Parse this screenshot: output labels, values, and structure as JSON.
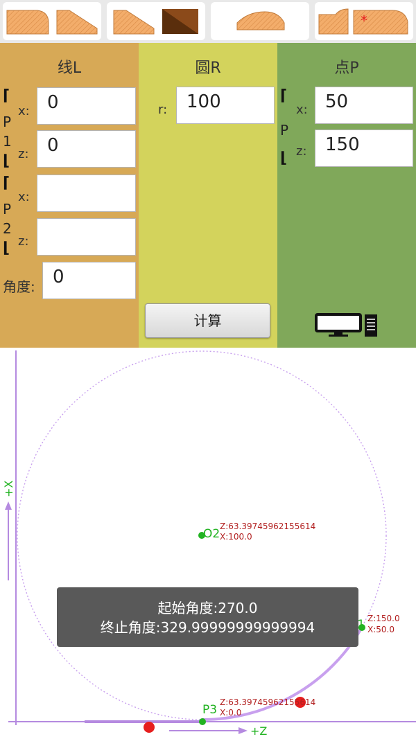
{
  "colors": {
    "shape_fill": "#f3ad6b",
    "shape_dark": "#8b4a1a",
    "line_panel": "#d7a956",
    "circle_panel": "#d3d35c",
    "point_panel": "#80a85a",
    "axis": "#b58ae0",
    "arc": "#c8a0ee",
    "marker_green": "#22b322",
    "marker_red": "#e61e1e",
    "coord_text": "#b22020",
    "axis_text": "#22b322"
  },
  "tabs": [
    {
      "icon": "corner-bevel-shapes-icon"
    },
    {
      "icon": "bevel-line-shapes-icon"
    },
    {
      "icon": "arc-shape-icon"
    },
    {
      "icon": "curve-shapes-icon",
      "marker": "*"
    }
  ],
  "line_panel": {
    "title": "线L",
    "p1_label": "P\n1",
    "p2_label": "P\n2",
    "x_label": "x:",
    "z_label": "z:",
    "p1_x": "0",
    "p1_z": "0",
    "p2_x": "",
    "p2_z": "",
    "angle_label": "角度:",
    "angle": "0"
  },
  "circle_panel": {
    "title": "圆R",
    "r_label": "r:",
    "r": "100",
    "calc_label": "计算"
  },
  "point_panel": {
    "title": "点P",
    "p_label": "P",
    "x_label": "x:",
    "z_label": "z:",
    "x": "50",
    "z": "150",
    "icon": "computer-icon"
  },
  "canvas": {
    "x_axis_label": "+X",
    "z_axis_label": "+Z",
    "o2": {
      "name": "O2",
      "z": "Z:63.39745962155614",
      "x": "X:100.0"
    },
    "p1": {
      "name": "P1",
      "z": "Z:150.0",
      "x": "X:50.0"
    },
    "p3": {
      "name": "P3",
      "z": "Z:63.39745962155614",
      "x": "X:0.0"
    }
  },
  "toast": {
    "start_angle": "起始角度:270.0",
    "end_angle": "终止角度:329.99999999999994"
  }
}
